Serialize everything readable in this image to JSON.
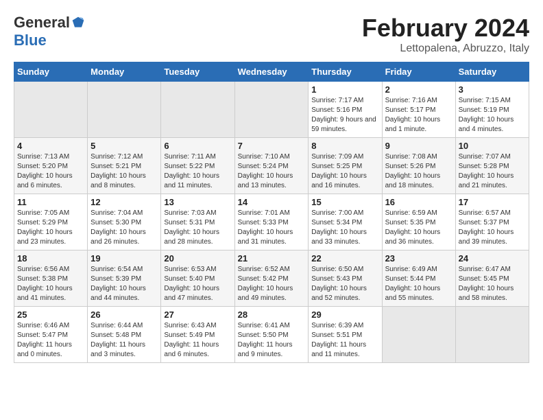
{
  "logo": {
    "general": "General",
    "blue": "Blue"
  },
  "title": {
    "month": "February 2024",
    "location": "Lettopalena, Abruzzo, Italy"
  },
  "weekdays": [
    "Sunday",
    "Monday",
    "Tuesday",
    "Wednesday",
    "Thursday",
    "Friday",
    "Saturday"
  ],
  "weeks": [
    [
      {
        "day": "",
        "info": ""
      },
      {
        "day": "",
        "info": ""
      },
      {
        "day": "",
        "info": ""
      },
      {
        "day": "",
        "info": ""
      },
      {
        "day": "1",
        "info": "Sunrise: 7:17 AM\nSunset: 5:16 PM\nDaylight: 9 hours and 59 minutes."
      },
      {
        "day": "2",
        "info": "Sunrise: 7:16 AM\nSunset: 5:17 PM\nDaylight: 10 hours and 1 minute."
      },
      {
        "day": "3",
        "info": "Sunrise: 7:15 AM\nSunset: 5:19 PM\nDaylight: 10 hours and 4 minutes."
      }
    ],
    [
      {
        "day": "4",
        "info": "Sunrise: 7:13 AM\nSunset: 5:20 PM\nDaylight: 10 hours and 6 minutes."
      },
      {
        "day": "5",
        "info": "Sunrise: 7:12 AM\nSunset: 5:21 PM\nDaylight: 10 hours and 8 minutes."
      },
      {
        "day": "6",
        "info": "Sunrise: 7:11 AM\nSunset: 5:22 PM\nDaylight: 10 hours and 11 minutes."
      },
      {
        "day": "7",
        "info": "Sunrise: 7:10 AM\nSunset: 5:24 PM\nDaylight: 10 hours and 13 minutes."
      },
      {
        "day": "8",
        "info": "Sunrise: 7:09 AM\nSunset: 5:25 PM\nDaylight: 10 hours and 16 minutes."
      },
      {
        "day": "9",
        "info": "Sunrise: 7:08 AM\nSunset: 5:26 PM\nDaylight: 10 hours and 18 minutes."
      },
      {
        "day": "10",
        "info": "Sunrise: 7:07 AM\nSunset: 5:28 PM\nDaylight: 10 hours and 21 minutes."
      }
    ],
    [
      {
        "day": "11",
        "info": "Sunrise: 7:05 AM\nSunset: 5:29 PM\nDaylight: 10 hours and 23 minutes."
      },
      {
        "day": "12",
        "info": "Sunrise: 7:04 AM\nSunset: 5:30 PM\nDaylight: 10 hours and 26 minutes."
      },
      {
        "day": "13",
        "info": "Sunrise: 7:03 AM\nSunset: 5:31 PM\nDaylight: 10 hours and 28 minutes."
      },
      {
        "day": "14",
        "info": "Sunrise: 7:01 AM\nSunset: 5:33 PM\nDaylight: 10 hours and 31 minutes."
      },
      {
        "day": "15",
        "info": "Sunrise: 7:00 AM\nSunset: 5:34 PM\nDaylight: 10 hours and 33 minutes."
      },
      {
        "day": "16",
        "info": "Sunrise: 6:59 AM\nSunset: 5:35 PM\nDaylight: 10 hours and 36 minutes."
      },
      {
        "day": "17",
        "info": "Sunrise: 6:57 AM\nSunset: 5:37 PM\nDaylight: 10 hours and 39 minutes."
      }
    ],
    [
      {
        "day": "18",
        "info": "Sunrise: 6:56 AM\nSunset: 5:38 PM\nDaylight: 10 hours and 41 minutes."
      },
      {
        "day": "19",
        "info": "Sunrise: 6:54 AM\nSunset: 5:39 PM\nDaylight: 10 hours and 44 minutes."
      },
      {
        "day": "20",
        "info": "Sunrise: 6:53 AM\nSunset: 5:40 PM\nDaylight: 10 hours and 47 minutes."
      },
      {
        "day": "21",
        "info": "Sunrise: 6:52 AM\nSunset: 5:42 PM\nDaylight: 10 hours and 49 minutes."
      },
      {
        "day": "22",
        "info": "Sunrise: 6:50 AM\nSunset: 5:43 PM\nDaylight: 10 hours and 52 minutes."
      },
      {
        "day": "23",
        "info": "Sunrise: 6:49 AM\nSunset: 5:44 PM\nDaylight: 10 hours and 55 minutes."
      },
      {
        "day": "24",
        "info": "Sunrise: 6:47 AM\nSunset: 5:45 PM\nDaylight: 10 hours and 58 minutes."
      }
    ],
    [
      {
        "day": "25",
        "info": "Sunrise: 6:46 AM\nSunset: 5:47 PM\nDaylight: 11 hours and 0 minutes."
      },
      {
        "day": "26",
        "info": "Sunrise: 6:44 AM\nSunset: 5:48 PM\nDaylight: 11 hours and 3 minutes."
      },
      {
        "day": "27",
        "info": "Sunrise: 6:43 AM\nSunset: 5:49 PM\nDaylight: 11 hours and 6 minutes."
      },
      {
        "day": "28",
        "info": "Sunrise: 6:41 AM\nSunset: 5:50 PM\nDaylight: 11 hours and 9 minutes."
      },
      {
        "day": "29",
        "info": "Sunrise: 6:39 AM\nSunset: 5:51 PM\nDaylight: 11 hours and 11 minutes."
      },
      {
        "day": "",
        "info": ""
      },
      {
        "day": "",
        "info": ""
      }
    ]
  ]
}
